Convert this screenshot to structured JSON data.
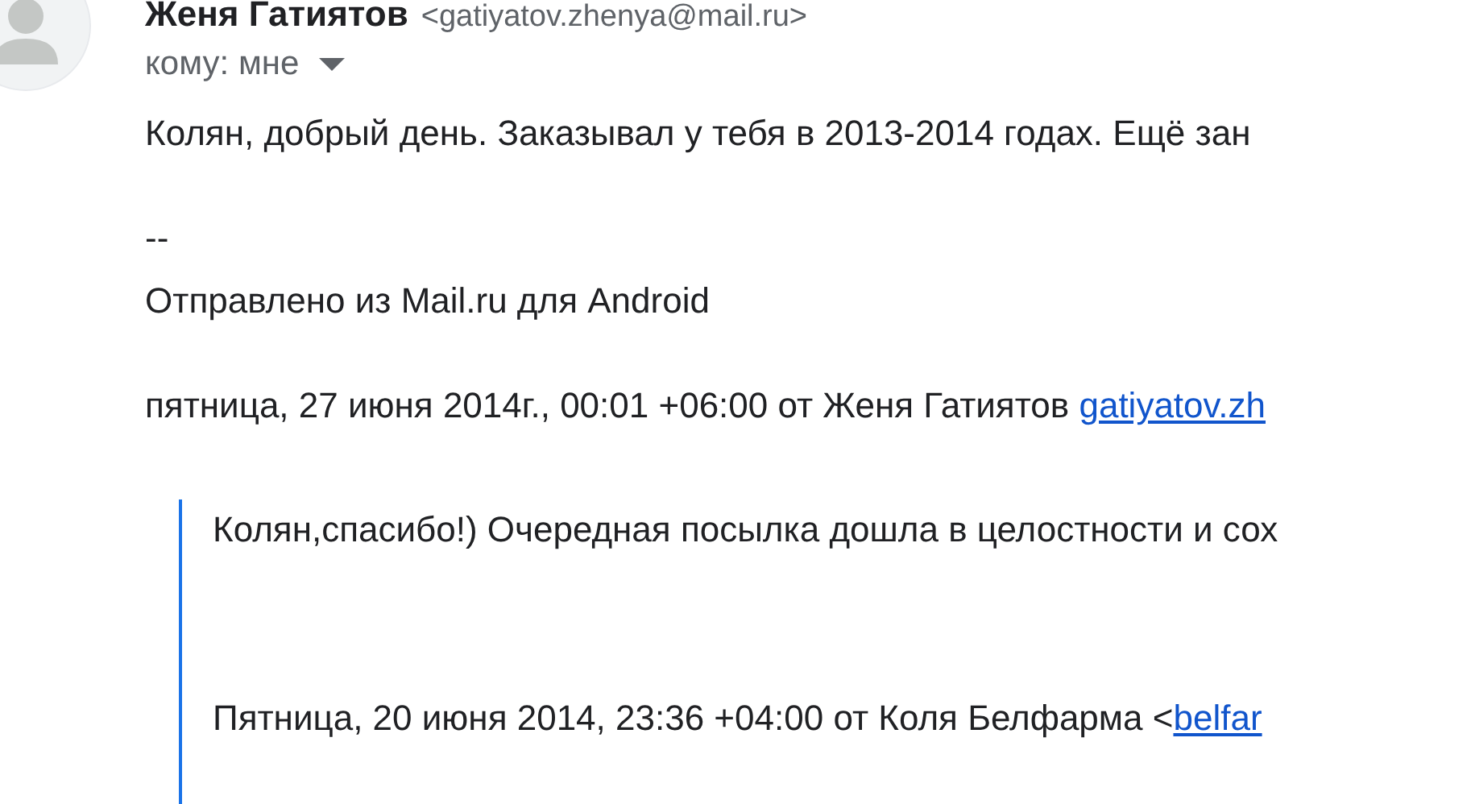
{
  "header": {
    "sender_name": "Женя Гатиятов",
    "sender_email": "<gatiyatov.zhenya@mail.ru>",
    "recipient": "кому: мне"
  },
  "body": {
    "greeting": "Колян, добрый день. Заказывал у тебя  в 2013-2014 годах. Ещё зан",
    "signature_sep": "--",
    "signature": "Отправлено из Mail.ru для Android",
    "reply_header": "пятница, 27 июня 2014г., 00:01 +06:00 от Женя Гатиятов ",
    "reply_link": "gatiyatov.zh"
  },
  "quote": {
    "text": "Колян,спасибо!) Очередная посылка дошла в целостности и сох",
    "reply_header": "Пятница, 20 июня 2014, 23:36 +04:00 от Коля Белфарма <",
    "reply_link": "belfar"
  }
}
